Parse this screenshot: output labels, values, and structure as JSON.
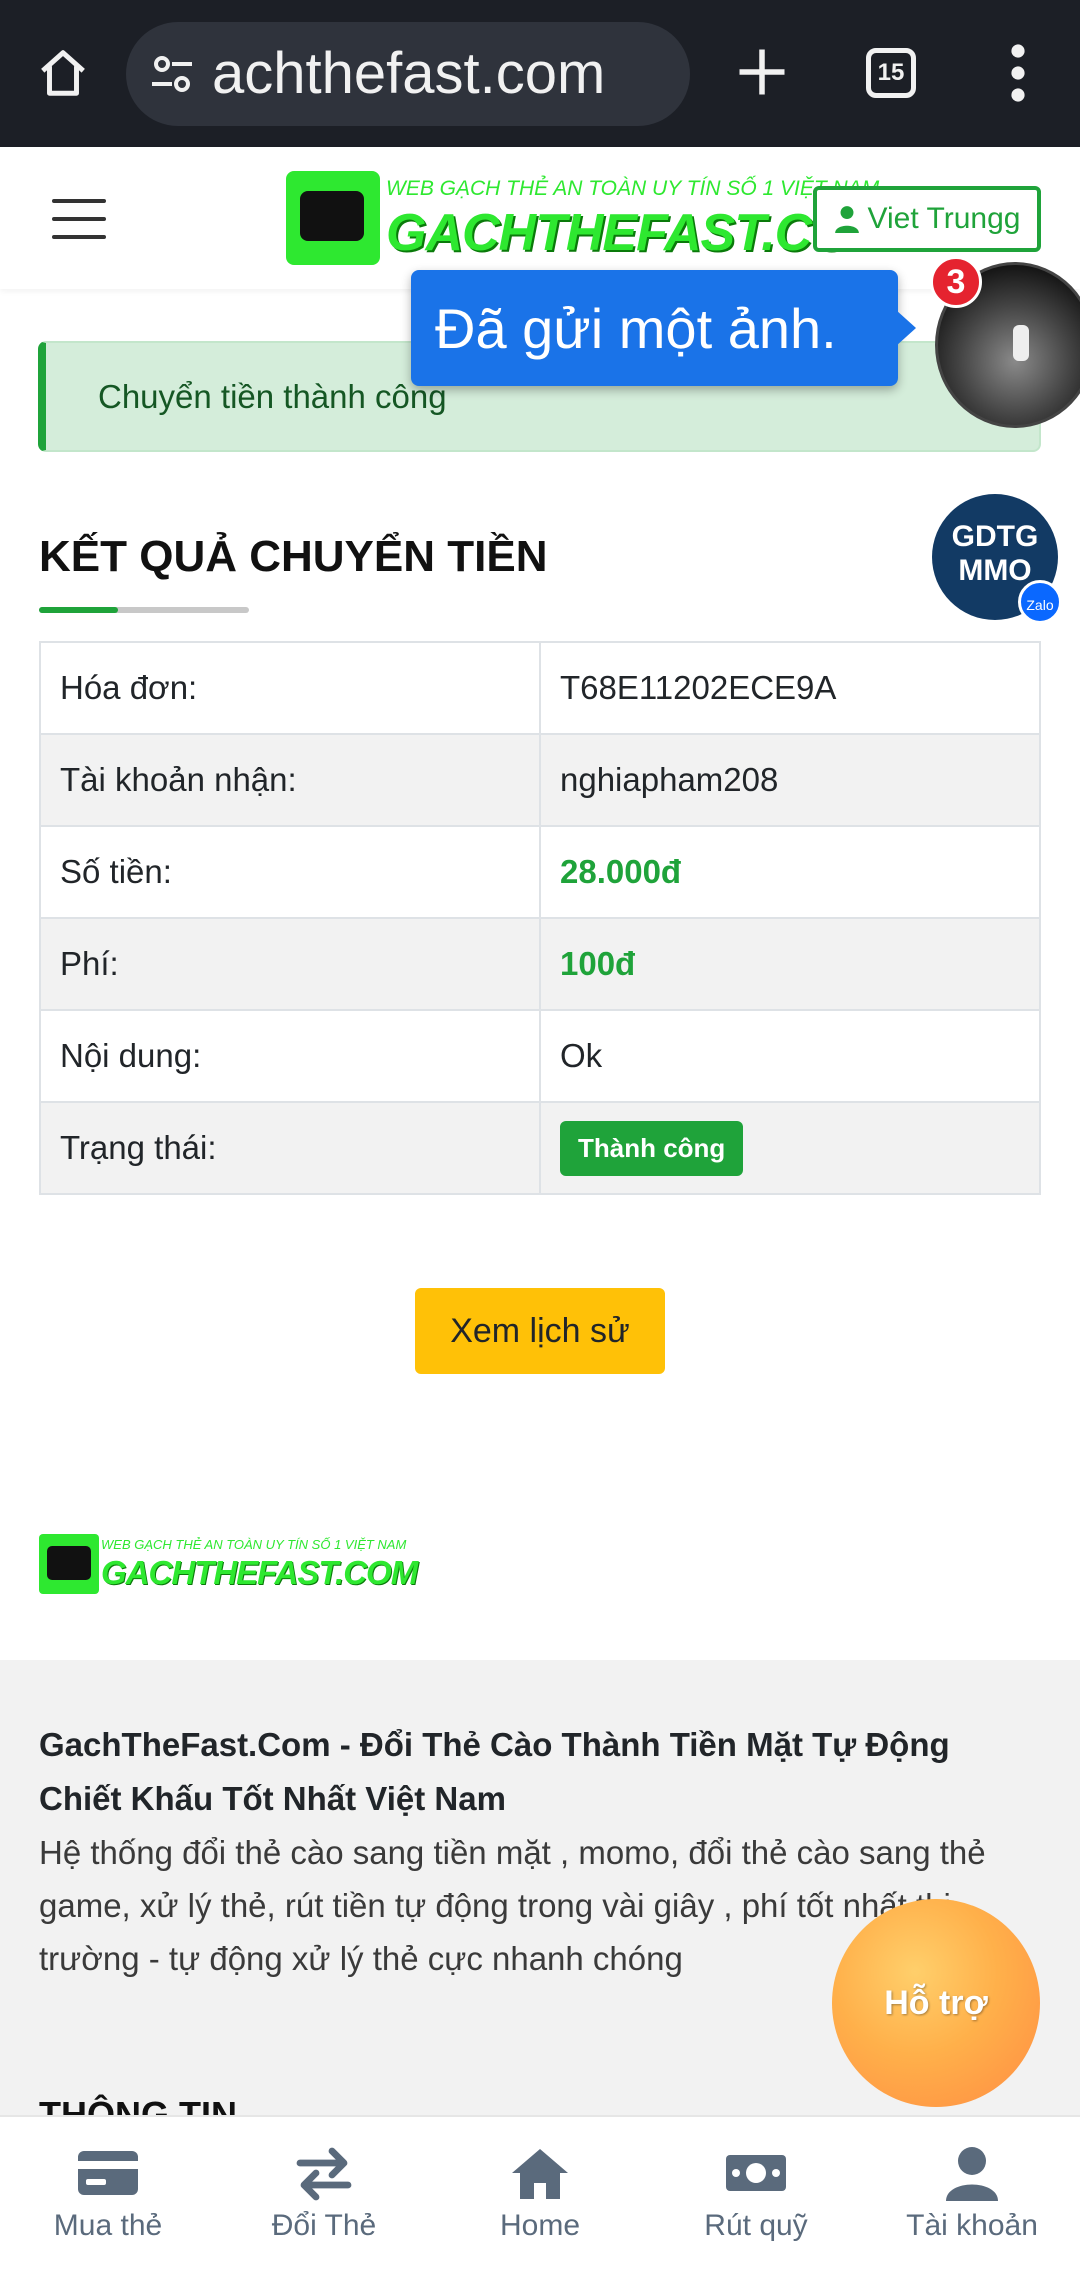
{
  "browser": {
    "url": "achthefast.com",
    "tab_count": "15"
  },
  "header": {
    "logo_tagline": "WEB GẠCH THẺ AN TOÀN UY TÍN SỐ 1 VIỆT NAM",
    "logo_name": "GACHTHEFAST.COM",
    "user_label": "Viet Trungg"
  },
  "alert": {
    "text": "Chuyển tiền thành công"
  },
  "chathead": {
    "message": "Đã gửi một ảnh.",
    "badge_count": "3"
  },
  "zalo": {
    "line1": "GDTG",
    "line2": "MMO",
    "badge": "Zalo"
  },
  "result": {
    "title": "KẾT QUẢ CHUYỂN TIỀN",
    "rows": [
      {
        "label": "Hóa đơn:",
        "value": "T68E11202ECE9A"
      },
      {
        "label": "Tài khoản nhận:",
        "value": "nghiapham208"
      },
      {
        "label": "Số tiền:",
        "value": "28.000đ"
      },
      {
        "label": "Phí:",
        "value": "100đ"
      },
      {
        "label": "Nội dung:",
        "value": "Ok"
      },
      {
        "label": "Trạng thái:",
        "value": "Thành công"
      }
    ],
    "history_button": "Xem lịch sử"
  },
  "footer": {
    "heading": "GachTheFast.Com - Đổi Thẻ Cào Thành Tiền Mặt Tự Động Chiết Khấu Tốt Nhất Việt Nam",
    "description": "Hệ thống đổi thẻ cào sang tiền mặt , momo, đổi thẻ cào sang thẻ game, xử lý thẻ, rút tiền tự động trong vài giây , phí tốt nhất thị trường - tự động xử lý thẻ cực nhanh chóng",
    "section_title": "THÔNG TIN",
    "support_button": "Hỗ trợ"
  },
  "bottom_nav": [
    {
      "label": "Mua thẻ",
      "icon": "card-icon"
    },
    {
      "label": "Đổi Thẻ",
      "icon": "exchange-icon"
    },
    {
      "label": "Home",
      "icon": "home-icon"
    },
    {
      "label": "Rút quỹ",
      "icon": "money-icon"
    },
    {
      "label": "Tài khoản",
      "icon": "user-icon"
    }
  ],
  "colors": {
    "success_green": "#1fa33a",
    "warning_yellow": "#ffc107",
    "logo_green": "#2ee830",
    "chrome_dark": "#1c1f26",
    "chat_blue": "#1a73e8"
  }
}
